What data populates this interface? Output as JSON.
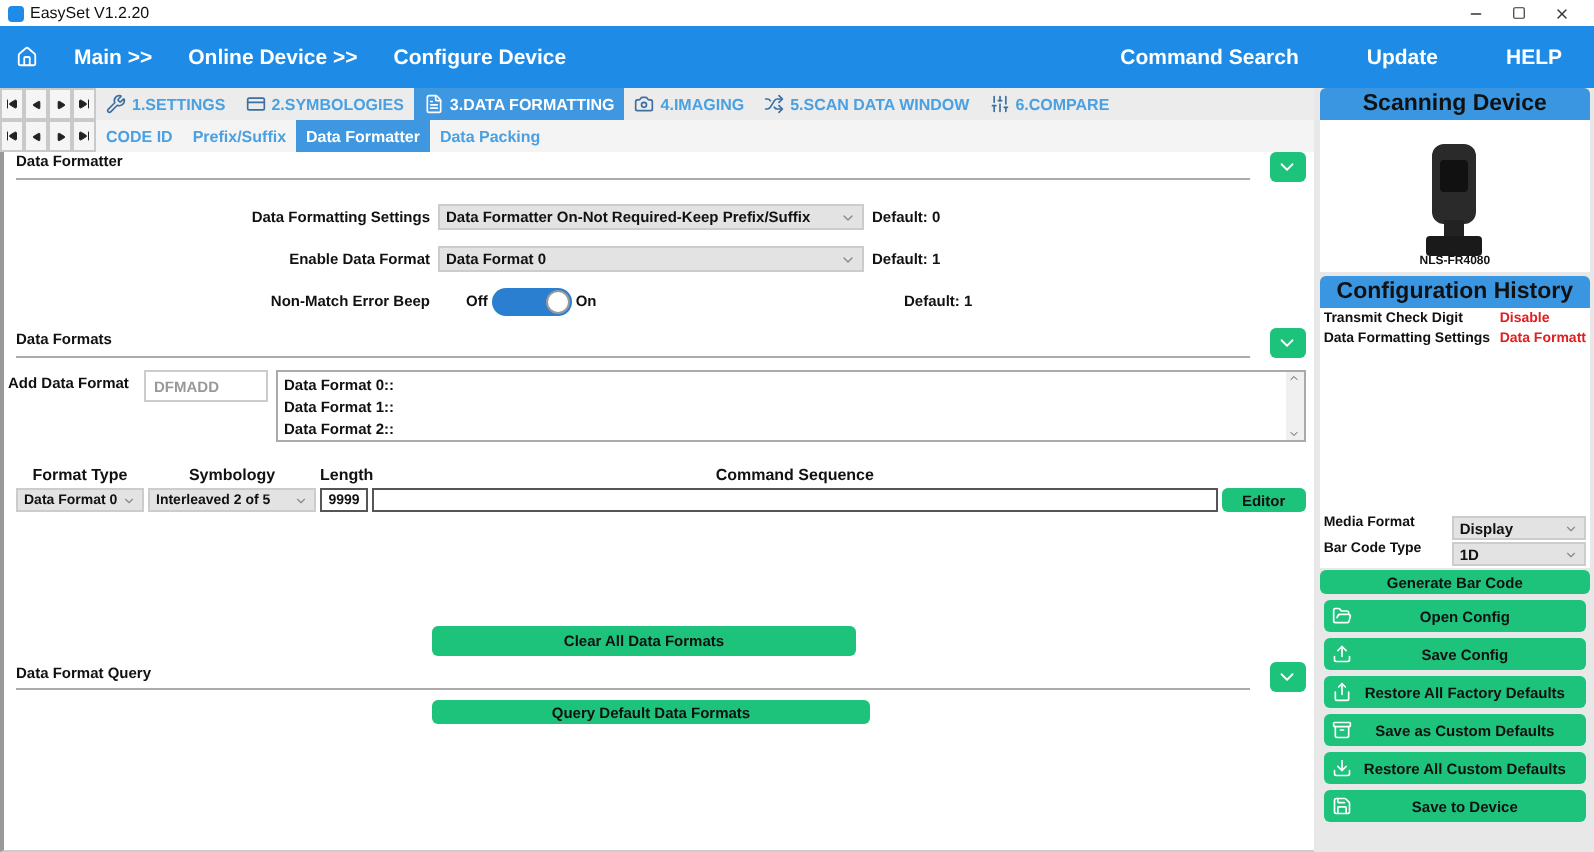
{
  "window": {
    "title": "EasySet V1.2.20"
  },
  "nav": {
    "breadcrumbs": [
      "Main >>",
      "Online Device >>",
      "Configure Device"
    ],
    "links": [
      "Command Search",
      "Update",
      "HELP"
    ]
  },
  "tabs": [
    {
      "kind": "tools",
      "label": "1.SETTINGS",
      "selected": false
    },
    {
      "kind": "card",
      "label": "2.SYMBOLOGIES",
      "selected": false
    },
    {
      "kind": "doc",
      "label": "3.DATA FORMATTING",
      "selected": true
    },
    {
      "kind": "camera",
      "label": "4.IMAGING",
      "selected": false
    },
    {
      "kind": "shuffle",
      "label": "5.SCAN DATA WINDOW",
      "selected": false
    },
    {
      "kind": "sliders",
      "label": "6.COMPARE",
      "selected": false
    }
  ],
  "subtabs": [
    {
      "label": "CODE ID",
      "selected": false
    },
    {
      "label": "Prefix/Suffix",
      "selected": false
    },
    {
      "label": "Data Formatter",
      "selected": true
    },
    {
      "label": "Data Packing",
      "selected": false
    }
  ],
  "data_formatter": {
    "title": "Data Formatter",
    "settings": [
      {
        "kind": "select",
        "label": "Data Formatting Settings",
        "value": "Data Formatter On-Not Required-Keep Prefix/Suffix",
        "default": "Default: 0"
      },
      {
        "kind": "select",
        "label": "Enable Data Format",
        "value": "Data Format 0",
        "default": "Default: 1"
      },
      {
        "kind": "toggle",
        "label": "Non-Match Error Beep",
        "off_label": "Off",
        "on_label": "On",
        "on": true,
        "default": "Default: 1"
      }
    ]
  },
  "data_formats": {
    "title": "Data Formats",
    "add_label": "Add Data Format",
    "add_placeholder": "DFMADD",
    "list": [
      "Data Format 0::",
      "Data Format 1::",
      "Data Format 2::"
    ],
    "columns": [
      "Format Type",
      "Symbology",
      "Length",
      "Command Sequence"
    ],
    "format_type": "Data Format 0",
    "symbology": "Interleaved 2 of 5",
    "length": "9999",
    "editor_button": "Editor",
    "clear_button": "Clear All Data Formats"
  },
  "query": {
    "title": "Data Format Query",
    "button": "Query Default Data Formats"
  },
  "scanning_device": {
    "title": "Scanning Device",
    "model": "NLS-FR4080"
  },
  "history": {
    "title": "Configuration History",
    "rows": [
      {
        "name": "Transmit Check Digit",
        "value": "Disable"
      },
      {
        "name": "Data Formatting Settings",
        "value": "Data Formatt"
      }
    ],
    "media_format_label": "Media Format",
    "media_format": "Display",
    "bar_code_type_label": "Bar Code Type",
    "bar_code_type": "1D",
    "generate_button": "Generate Bar Code"
  },
  "actions": [
    {
      "kind": "open",
      "label": "Open Config"
    },
    {
      "kind": "save",
      "label": "Save Config"
    },
    {
      "kind": "restore",
      "label": "Restore All Factory Defaults"
    },
    {
      "kind": "custom",
      "label": "Save as Custom Defaults"
    },
    {
      "kind": "restore_custom",
      "label": "Restore All Custom Defaults"
    },
    {
      "kind": "device",
      "label": "Save to Device"
    }
  ]
}
